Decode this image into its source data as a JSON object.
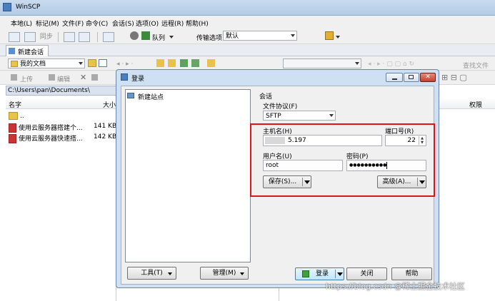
{
  "app": {
    "title": "WinSCP"
  },
  "menu": [
    "本地(L)",
    "标记(M)",
    "文件(F)",
    "命令(C)",
    "会话(S)",
    "选项(O)",
    "远程(R)",
    "帮助(H)"
  ],
  "toolbar": {
    "sync_label": "同步",
    "queue_label": "队列",
    "transfer_label": "传输选项",
    "transfer_value": "默认"
  },
  "session_tab": {
    "label": "新建会话"
  },
  "local": {
    "location": "我的文档",
    "upload_label": "上传",
    "edit_label": "编辑",
    "path": "C:\\Users\\pan\\Documents\\",
    "columns": {
      "name": "名字",
      "size": "大小"
    },
    "files": [
      {
        "name": "..",
        "size": "",
        "type": "parent"
      },
      {
        "name": "使用云服务器搭建个...",
        "size": "141 KB",
        "type": "file"
      },
      {
        "name": "使用云服务器快速搭...",
        "size": "142 KB",
        "type": "file"
      }
    ]
  },
  "remote": {
    "find_label": "查找文件",
    "columns": {
      "rights": "权限"
    }
  },
  "dialog": {
    "title": "登录",
    "sites": [
      {
        "label": "新建站点"
      }
    ],
    "tools_label": "工具(T)",
    "manage_label": "管理(M)",
    "session_group": "会话",
    "protocol_label": "文件协议(F)",
    "protocol_value": "SFTP",
    "host_label": "主机名(H)",
    "host_value": "5.197",
    "port_label": "端口号(R)",
    "port_value": "22",
    "user_label": "用户名(U)",
    "user_value": "root",
    "password_label": "密码(P)",
    "password_value": "●●●●●●●●●●",
    "save_label": "保存(S)...",
    "advanced_label": "高级(A)...",
    "login_label": "登录",
    "close_label": "关闭",
    "help_label": "帮助"
  },
  "watermark": "https://blog.csdn @稀土掘金技术社区",
  "colors": {
    "highlight_box": "#e0121b",
    "title_bg": "#c9dbef"
  }
}
